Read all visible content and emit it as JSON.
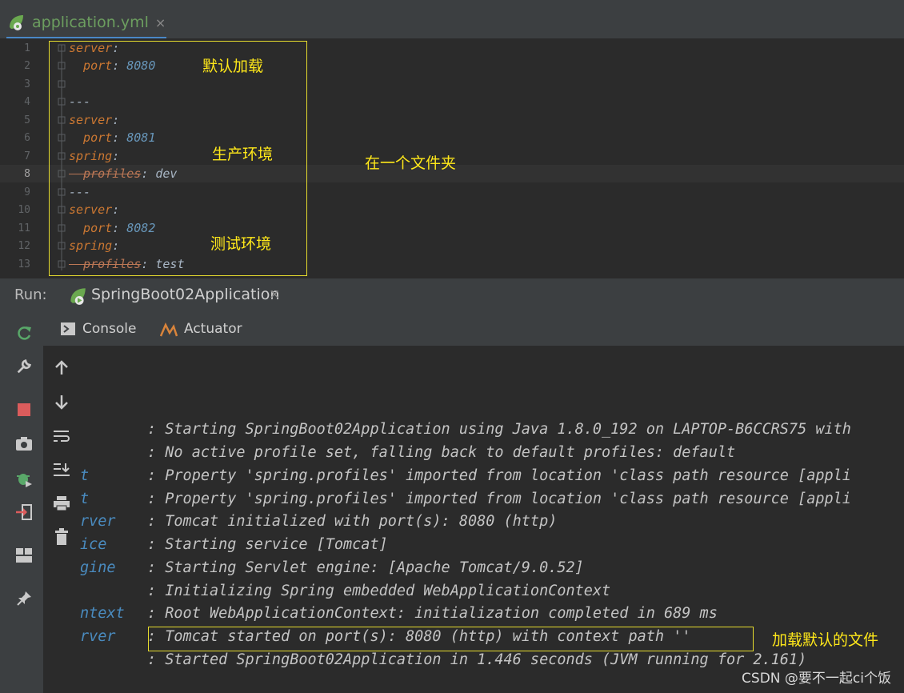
{
  "editor_tab": {
    "filename": "application.yml",
    "close": "×"
  },
  "editor": {
    "line_numbers": [
      "1",
      "2",
      "3",
      "4",
      "5",
      "6",
      "7",
      "8",
      "9",
      "10",
      "11",
      "12",
      "13"
    ],
    "lines": [
      {
        "key": "server",
        "sep": ":",
        "val": ""
      },
      {
        "key": "  port",
        "sep": ": ",
        "val": "8080"
      },
      {
        "key": "",
        "sep": "",
        "val": ""
      },
      {
        "key": "---",
        "sep": "",
        "val": ""
      },
      {
        "key": "server",
        "sep": ":",
        "val": ""
      },
      {
        "key": "  port",
        "sep": ": ",
        "val": "8081"
      },
      {
        "key": "spring",
        "sep": ":",
        "val": ""
      },
      {
        "key": "  profiles",
        "sep": ": ",
        "val": "dev"
      },
      {
        "key": "---",
        "sep": "",
        "val": ""
      },
      {
        "key": "server",
        "sep": ":",
        "val": ""
      },
      {
        "key": "  port",
        "sep": ": ",
        "val": "8082"
      },
      {
        "key": "spring",
        "sep": ":",
        "val": ""
      },
      {
        "key": "  profiles",
        "sep": ": ",
        "val": "test"
      }
    ]
  },
  "annotations": {
    "default_load": "默认加载",
    "production": "生产环境",
    "test_env": "测试环境",
    "same_folder": "在一个文件夹",
    "load_default_file": "加载默认的文件"
  },
  "run": {
    "label": "Run:",
    "config_name": "SpringBoot02Application",
    "close": "×",
    "tabs": [
      "Console",
      "Actuator"
    ]
  },
  "console": {
    "lines": [
      {
        "src": "",
        "msg": ": Starting SpringBoot02Application using Java 1.8.0_192 on LAPTOP-B6CCRS75 with"
      },
      {
        "src": "",
        "msg": ": No active profile set, falling back to default profiles: default"
      },
      {
        "src": "t",
        "msg": ": Property 'spring.profiles' imported from location 'class path resource [appli"
      },
      {
        "src": "t",
        "msg": ": Property 'spring.profiles' imported from location 'class path resource [appli"
      },
      {
        "src": "rver",
        "msg": ": Tomcat initialized with port(s): 8080 (http)"
      },
      {
        "src": "ice",
        "msg": ": Starting service [Tomcat]"
      },
      {
        "src": "gine",
        "msg": ": Starting Servlet engine: [Apache Tomcat/9.0.52]"
      },
      {
        "src": "",
        "msg": ": Initializing Spring embedded WebApplicationContext"
      },
      {
        "src": "ntext",
        "msg": ": Root WebApplicationContext: initialization completed in 689 ms"
      },
      {
        "src": "rver",
        "msg": ": Tomcat started on port(s): 8080 (http) with context path ''"
      },
      {
        "src": "",
        "msg": ": Started SpringBoot02Application in 1.446 seconds (JVM running for 2.161)"
      }
    ]
  },
  "watermark": "CSDN @要不一起ci个饭",
  "colors": {
    "accent": "#4a88c7",
    "annotation": "#ffe81a",
    "key": "#cc7832",
    "number": "#6897bb"
  }
}
